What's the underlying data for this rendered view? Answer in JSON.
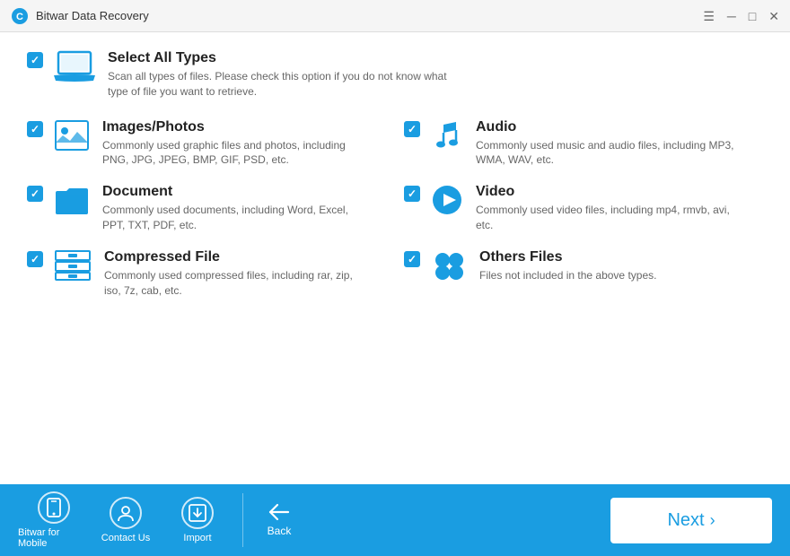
{
  "titleBar": {
    "title": "Bitwar Data Recovery",
    "controls": {
      "menu": "☰",
      "minimize": "─",
      "maximize": "□",
      "close": "✕"
    }
  },
  "selectAll": {
    "label": "Select All Types",
    "description": "Scan all types of files. Please check this option if you do not know what type of file you want to retrieve.",
    "checked": true
  },
  "fileTypes": [
    {
      "id": "images",
      "label": "Images/Photos",
      "description": "Commonly used graphic files and photos, including PNG, JPG, JPEG, BMP, GIF, PSD, etc.",
      "checked": true,
      "iconType": "image"
    },
    {
      "id": "audio",
      "label": "Audio",
      "description": "Commonly used music and audio files, including MP3, WMA, WAV, etc.",
      "checked": true,
      "iconType": "audio"
    },
    {
      "id": "document",
      "label": "Document",
      "description": "Commonly used documents, including Word, Excel, PPT, TXT, PDF, etc.",
      "checked": true,
      "iconType": "document"
    },
    {
      "id": "video",
      "label": "Video",
      "description": "Commonly used video files, including mp4, rmvb, avi, etc.",
      "checked": true,
      "iconType": "video"
    },
    {
      "id": "compressed",
      "label": "Compressed File",
      "description": "Commonly used compressed files, including rar, zip, iso, 7z, cab, etc.",
      "checked": true,
      "iconType": "compressed"
    },
    {
      "id": "others",
      "label": "Others Files",
      "description": "Files not included in the above types.",
      "checked": true,
      "iconType": "others"
    }
  ],
  "bottomBar": {
    "mobileBtn": "Bitwar for Mobile",
    "contactBtn": "Contact Us",
    "importBtn": "Import",
    "backBtn": "Back",
    "nextBtn": "Next"
  },
  "colors": {
    "primary": "#1a9de1",
    "checkmark": "#ffffff"
  }
}
